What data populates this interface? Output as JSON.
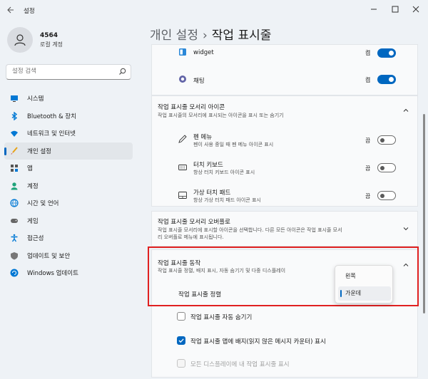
{
  "window": {
    "title": "설정"
  },
  "profile": {
    "name": "4564",
    "account_type": "로컬 계정"
  },
  "search": {
    "placeholder": "설정 검색"
  },
  "sidebar": {
    "items": [
      {
        "label": "시스템",
        "icon": "system-icon"
      },
      {
        "label": "Bluetooth & 장치",
        "icon": "bluetooth-icon"
      },
      {
        "label": "네트워크 및 인터넷",
        "icon": "wifi-icon"
      },
      {
        "label": "개인 설정",
        "icon": "brush-icon",
        "active": true
      },
      {
        "label": "앱",
        "icon": "apps-icon"
      },
      {
        "label": "계정",
        "icon": "account-icon"
      },
      {
        "label": "시간 및 언어",
        "icon": "globe-clock-icon"
      },
      {
        "label": "게임",
        "icon": "gamepad-icon"
      },
      {
        "label": "접근성",
        "icon": "accessibility-icon"
      },
      {
        "label": "업데이트 및 보안",
        "icon": "shield-icon"
      },
      {
        "label": "Windows 업데이트",
        "icon": "update-icon"
      }
    ]
  },
  "breadcrumb": {
    "parent": "개인 설정",
    "separator": "›",
    "current": "작업 표시줄"
  },
  "taskbar_items": {
    "widget": {
      "label": "widget",
      "state": "켬"
    },
    "chat": {
      "label": "채팅",
      "state": "켬"
    }
  },
  "corner_icons": {
    "title": "작업 표시줄 모서리 아이콘",
    "subtitle": "작업 표시줄의 모서리에 표시되는 아이콘을 표시 또는 숨기기",
    "items": [
      {
        "title": "펜 메뉴",
        "subtitle": "펜이 사용 중일 때 펜 메뉴 아이콘 표시",
        "state": "끔"
      },
      {
        "title": "터치 키보드",
        "subtitle": "항상 터치 키보드 아이콘 표시",
        "state": "끔"
      },
      {
        "title": "가상 터치 패드",
        "subtitle": "항상 가상 터치 패드 아이콘 표시",
        "state": "끔"
      }
    ]
  },
  "overflow": {
    "title": "작업 표시줄 모서리 오버플로",
    "subtitle_line1": "작업 표시줄 모서리에 표시할 아이콘을 선택합니다. 다른 모든 아이콘은 작업 표시줄 모서",
    "subtitle_line2": "리 오버플로 메뉴에 표시됩니다."
  },
  "behaviors": {
    "title": "작업 표시줄 동작",
    "subtitle": "작업 표시줄 정렬, 배지 표시, 자동 숨기기 및 다중 디스플레이",
    "alignment_label": "작업 표시줄 정렬",
    "alignment_options": [
      "왼쪽",
      "가운데"
    ],
    "alignment_selected": "가운데",
    "checks": [
      {
        "label": "작업 표시줄 자동 숨기기",
        "checked": false,
        "disabled": false
      },
      {
        "label": "작업 표시줄 앱에 배지(읽지 않은 메시지 카운터) 표시",
        "checked": true,
        "disabled": false
      },
      {
        "label": "모든 디스플레이에 내 작업 표시줄 표시",
        "checked": false,
        "disabled": true
      }
    ]
  },
  "colors": {
    "accent": "#0067c0",
    "highlight_border": "#e02020"
  }
}
